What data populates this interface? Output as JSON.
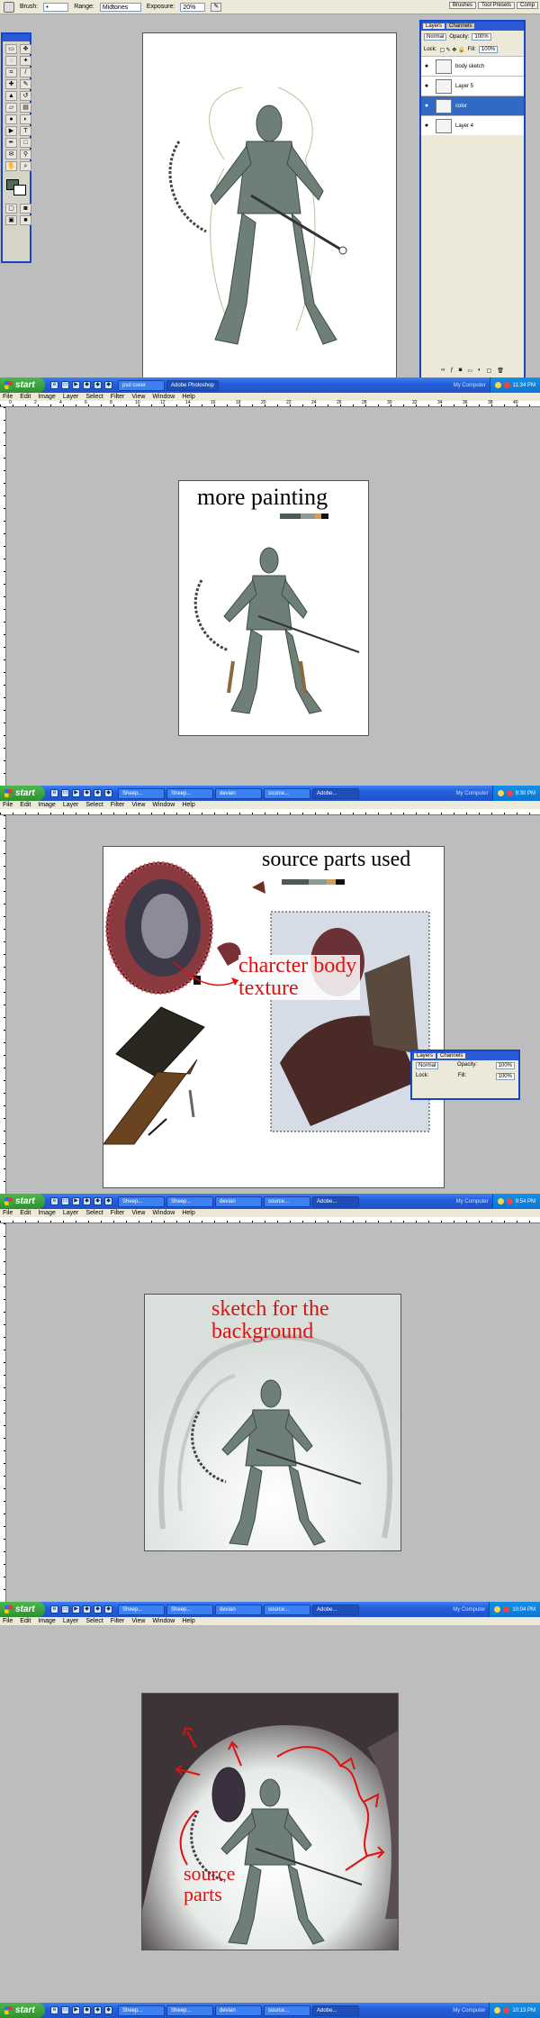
{
  "section1": {
    "options_bar": {
      "brush_label": "Brush:",
      "range_label": "Range:",
      "range_value": "Midtones",
      "exposure_label": "Exposure:",
      "exposure_value": "20%",
      "palette_tabs": [
        "Brushes",
        "Tool Presets",
        "Comp"
      ]
    },
    "layers_panel": {
      "tabs": [
        "Layers",
        "Channels"
      ],
      "blend_mode": "Normal",
      "opacity_label": "Opacity:",
      "opacity_value": "100%",
      "lock_label": "Lock:",
      "fill_label": "Fill:",
      "fill_value": "100%",
      "layers": [
        {
          "name": "body sketch",
          "selected": false
        },
        {
          "name": "Layer 5",
          "selected": false
        },
        {
          "name": "color",
          "selected": true
        },
        {
          "name": "Layer 4",
          "selected": false
        }
      ]
    },
    "taskbar": {
      "start": "start",
      "tasks": [
        "psd cover",
        "Adobe Photoshop"
      ],
      "active_task": 1,
      "tray_label": "My Computer",
      "time": "11:34 PM"
    }
  },
  "menu_items": [
    "File",
    "Edit",
    "Image",
    "Layer",
    "Select",
    "Filter",
    "View",
    "Window",
    "Help"
  ],
  "ruler_numbers": [
    "0",
    "2",
    "4",
    "6",
    "8",
    "10",
    "12",
    "14",
    "16",
    "18",
    "20",
    "22",
    "24",
    "26",
    "28",
    "30",
    "32",
    "34",
    "36",
    "38",
    "40",
    "42",
    "44"
  ],
  "section2": {
    "caption": "more painting",
    "taskbar": {
      "start": "start",
      "tasks": [
        "Sheep...",
        "Sheep...",
        "devian",
        "source...",
        "Adobe..."
      ],
      "active_task": 4,
      "tray_label": "My Computer",
      "time": "9:30 PM"
    }
  },
  "section3": {
    "caption_top": "source parts used",
    "caption_body_line1": "charcter body",
    "caption_body_line2": "texture",
    "mini_layers": {
      "tabs": [
        "Layers",
        "Channels"
      ],
      "blend_mode": "Normal",
      "opacity_label": "Opacity:",
      "opacity_value": "100%",
      "lock_label": "Lock:",
      "fill_label": "Fill:",
      "fill_value": "100%"
    },
    "taskbar": {
      "start": "start",
      "tasks": [
        "Sheep...",
        "Sheep...",
        "devian",
        "source...",
        "Adobe..."
      ],
      "active_task": 4,
      "tray_label": "My Computer",
      "time": "9:54 PM"
    }
  },
  "section4": {
    "caption_line1": "sketch for the",
    "caption_line2": "background",
    "taskbar": {
      "start": "start",
      "tasks": [
        "Sheep...",
        "Sheep...",
        "devian",
        "source...",
        "Adobe..."
      ],
      "active_task": 4,
      "tray_label": "My Computer",
      "time": "10:04 PM"
    }
  },
  "section5": {
    "caption_line1": "source",
    "caption_line2": "parts",
    "taskbar": {
      "start": "start",
      "tasks": [
        "Sheep...",
        "Sheep...",
        "devian",
        "source...",
        "Adobe..."
      ],
      "active_task": 4,
      "tray_label": "My Computer",
      "time": "10:13 PM"
    }
  },
  "colors": {
    "xp_blue": "#245edb",
    "start_green": "#2f8f2f",
    "annotation_red": "#e01010",
    "figure_gray": "#5d6d66",
    "swatch_dark": "#4d5a52",
    "swatch_mid": "#8e9b95"
  }
}
